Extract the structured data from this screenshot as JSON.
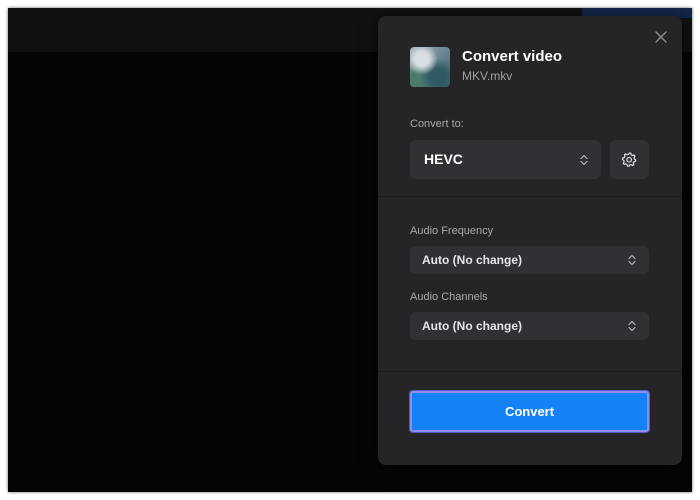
{
  "dialog": {
    "title": "Convert video",
    "filename": "MKV.mkv",
    "close_icon": "close-icon"
  },
  "convert_to": {
    "label": "Convert to:",
    "selected": "HEVC",
    "settings_icon": "gear-icon"
  },
  "audio_frequency": {
    "label": "Audio Frequency",
    "selected": "Auto (No change)"
  },
  "audio_channels": {
    "label": "Audio Channels",
    "selected": "Auto (No change)"
  },
  "action": {
    "convert_label": "Convert"
  },
  "colors": {
    "panel_bg": "#252528",
    "control_bg": "#313135",
    "accent_blue": "#1481f5",
    "focus_ring": "#8f8cf0"
  }
}
